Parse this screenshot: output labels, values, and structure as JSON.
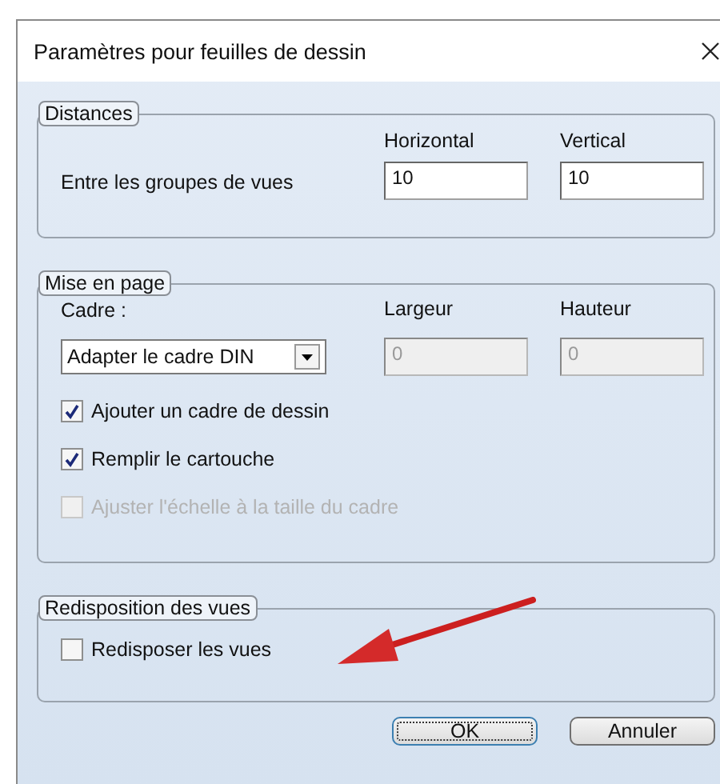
{
  "window": {
    "title": "Paramètres pour feuilles de dessin"
  },
  "distances": {
    "legend": "Distances",
    "row_label": "Entre les groupes de vues",
    "fields": [
      {
        "label": "Horizontal",
        "value": "10",
        "disabled": false
      },
      {
        "label": "Vertical",
        "value": "10",
        "disabled": false
      }
    ]
  },
  "layout": {
    "legend": "Mise en page",
    "frame_label": "Cadre :",
    "frame_value": "Adapter le cadre DIN",
    "fields": [
      {
        "label": "Largeur",
        "value": "0",
        "disabled": true
      },
      {
        "label": "Hauteur",
        "value": "0",
        "disabled": true
      }
    ],
    "checkboxes": [
      {
        "label": "Ajouter un cadre de dessin",
        "checked": true,
        "disabled": false
      },
      {
        "label": "Remplir le cartouche",
        "checked": true,
        "disabled": false
      },
      {
        "label": "Ajuster l'échelle à la taille du cadre",
        "checked": false,
        "disabled": true
      }
    ]
  },
  "rearrange": {
    "legend": "Redisposition des vues",
    "checkboxes": [
      {
        "label": "Redisposer les vues",
        "checked": false,
        "disabled": false
      }
    ]
  },
  "buttons": [
    {
      "label": "OK",
      "focused": true
    },
    {
      "label": "Annuler",
      "focused": false
    }
  ]
}
